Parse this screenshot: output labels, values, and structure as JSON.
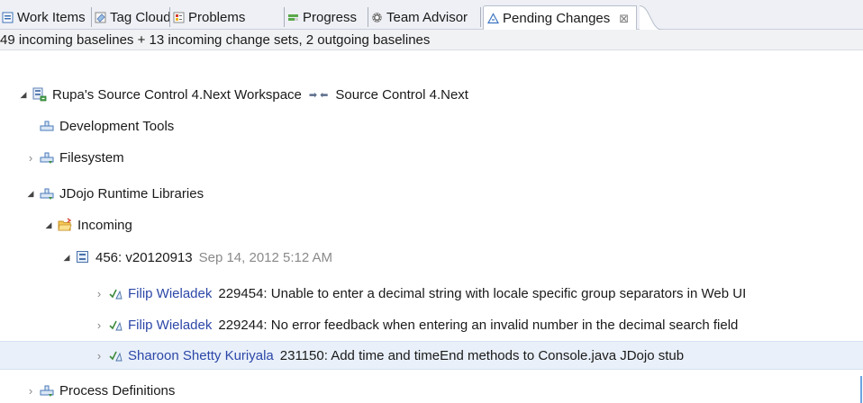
{
  "tabs": [
    {
      "label": "Work Items",
      "icon": "work-items-icon"
    },
    {
      "label": "Tag Cloud",
      "icon": "tag-cloud-icon"
    },
    {
      "label": "Problems",
      "icon": "problems-icon"
    },
    {
      "label": "Progress",
      "icon": "progress-icon"
    },
    {
      "label": "Team Advisor",
      "icon": "gear-icon"
    },
    {
      "label": "Pending Changes",
      "icon": "pending-changes-icon",
      "close": "⊠"
    }
  ],
  "summary": "49 incoming baselines + 13 incoming change sets, 2 outgoing baselines",
  "workspace": {
    "name": "Rupa's Source Control 4.Next Workspace",
    "flow_arrows": "➡ ⬅",
    "flow_target": "Source Control 4.Next"
  },
  "components": {
    "development_tools": "Development Tools",
    "filesystem": "Filesystem",
    "jdojo": "JDojo Runtime Libraries",
    "process_definitions": "Process Definitions"
  },
  "incoming": {
    "label": "Incoming",
    "baseline": {
      "name": "456: v20120913",
      "date": "Sep 14, 2012 5:12 AM"
    },
    "change_sets": [
      {
        "author": "Filip Wieladek",
        "text": "229454: Unable to enter a decimal string with locale specific group separators in Web UI"
      },
      {
        "author": "Filip Wieladek",
        "text": "229244: No error feedback when entering an invalid number in the decimal search field"
      },
      {
        "author": "Sharoon Shetty Kuriyala",
        "text": "231150: Add time and timeEnd methods to Console.java JDojo stub",
        "selected": true
      }
    ]
  },
  "colors": {
    "author_link": "#2c47a8",
    "date_gray": "#8a8a8a",
    "selection": "#e9f0f9",
    "tab_bar": "#eef0f5"
  }
}
